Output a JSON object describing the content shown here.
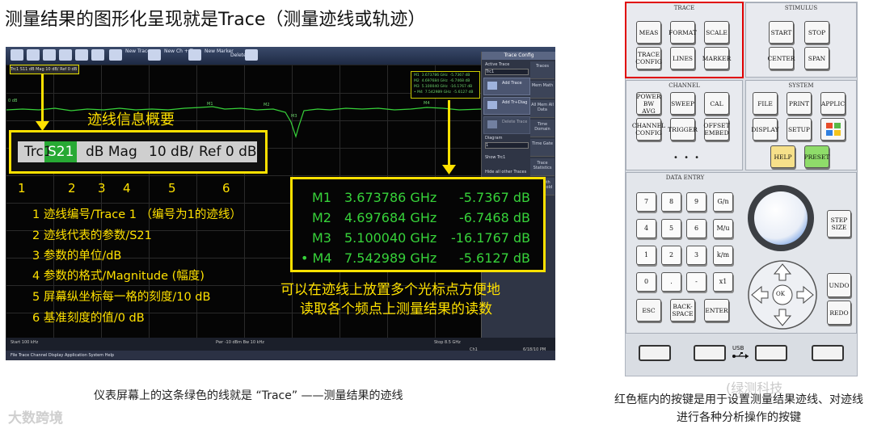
{
  "title": "测量结果的图形化呈现就是Trace（测量迹线或轨迹）",
  "screen": {
    "toolbar": [
      "New Trace",
      "New Ch + Tr",
      "New Marker",
      "Delete"
    ],
    "trace_pill": "Trc1 S11 dB Mag 10 dB/ Ref 0 dB",
    "y_label": "0 dB",
    "markers_on_trace": [
      "M1",
      "M2",
      "M3",
      "M4"
    ],
    "small_marker_rows": [
      "M1  3.673786 GHz  -5.7367 dB",
      "M2  4.697684 GHz  -6.7468 dB",
      "M3  5.100040 GHz  -16.1767 dB",
      "• M4  7.542989 GHz  -5.6127 dB"
    ],
    "status": {
      "start": "Start 100 kHz",
      "pwr": "Pwr -10 dBm  Bw 10 kHz",
      "stop": "Stop 8.5 GHz",
      "ch": "Ch1",
      "time": "6/18/10 PM"
    },
    "menu": "File  Trace  Channel  Display  Application  System  Help",
    "side_panel": {
      "title": "Trace Config",
      "active_trace_label": "Active Trace",
      "active_trace_value": "Trc1",
      "buttons": [
        "Add Trace",
        "Add Tr+Diag",
        "Delete Trace"
      ],
      "tabs": [
        "Traces",
        "Mem Math",
        "All Mem All Data",
        "Time Domain",
        "Time Gate",
        "Trace Statistics",
        "Smooth Shift Hold"
      ],
      "diagram_label": "Diagram",
      "diagram_value": "1",
      "show_label": "Show Trc1",
      "hide_label": "Hide all other Traces"
    }
  },
  "trace_info": {
    "caption": "迹线信息概要",
    "segments": [
      "Trc1",
      "S21",
      "dB Mag",
      "10 dB/",
      "Ref 0 dB"
    ],
    "numbers": [
      "1",
      "2",
      "3",
      "4",
      "5",
      "6"
    ],
    "legend": [
      "1 迹线编号/Trace 1 （编号为1的迹线）",
      "2 迹线代表的参数/S21",
      "3 参数的单位/dB",
      "4 参数的格式/Magnitude (幅度)",
      "5 屏幕纵坐标每一格的刻度/10 dB",
      "6 基准刻度的值/0 dB"
    ]
  },
  "markers": [
    {
      "name": "M1",
      "freq": "3.673786 GHz",
      "val": "-5.7367 dB"
    },
    {
      "name": "M2",
      "freq": "4.697684 GHz",
      "val": "-6.7468 dB"
    },
    {
      "name": "M3",
      "freq": "5.100040 GHz",
      "val": "-16.1767 dB"
    },
    {
      "name": "• M4",
      "freq": "7.542989 GHz",
      "val": "-5.6127 dB"
    }
  ],
  "marker_caption": [
    "可以在迹线上放置多个光标点方便地",
    "读取各个频点上测量结果的读数"
  ],
  "caption_left": "仪表屏幕上的这条绿色的线就是 “Trace” ——测量结果的迹线",
  "logo_left": "大数跨境",
  "caption_right": "红色框内的按键是用于设置测量结果迹线、对迹线进行各种分析操作的按键",
  "logo_right": "(绿测科技",
  "panel": {
    "trace_title": "TRACE",
    "trace_keys": [
      "MEAS",
      "FORMAT",
      "SCALE",
      "TRACE CONFIG",
      "LINES",
      "MARKER"
    ],
    "stimulus_title": "STIMULUS",
    "stimulus_keys": [
      "START",
      "STOP",
      "CENTER",
      "SPAN"
    ],
    "channel_title": "CHANNEL",
    "channel_keys": [
      "POWER BW AVG",
      "SWEEP",
      "CAL",
      "CHANNEL CONFIG",
      "TRIGGER",
      "OFFSET EMBED"
    ],
    "system_title": "SYSTEM",
    "system_keys": [
      "FILE",
      "PRINT",
      "APPLIC",
      "DISPLAY",
      "SETUP",
      "HELP",
      "PRESET"
    ],
    "data_entry_title": "DATA ENTRY",
    "num_keys": [
      "7",
      "8",
      "9",
      "G/n",
      "4",
      "5",
      "6",
      "M/u",
      "1",
      "2",
      "3",
      "k/m",
      "0",
      ".",
      "-",
      "x1"
    ],
    "bottom_keys": [
      "ESC",
      "BACK- SPACE",
      "ENTER"
    ],
    "step_size": "STEP SIZE",
    "undo": "UNDO",
    "redo": "REDO",
    "ok": "OK",
    "usb": "USB"
  },
  "colors": {
    "trace_green": "#37d23a",
    "highlight_yellow": "#ffe100",
    "red_frame": "#e00000",
    "help_key": "#f6e08a",
    "preset_key": "#8fdc6a"
  }
}
